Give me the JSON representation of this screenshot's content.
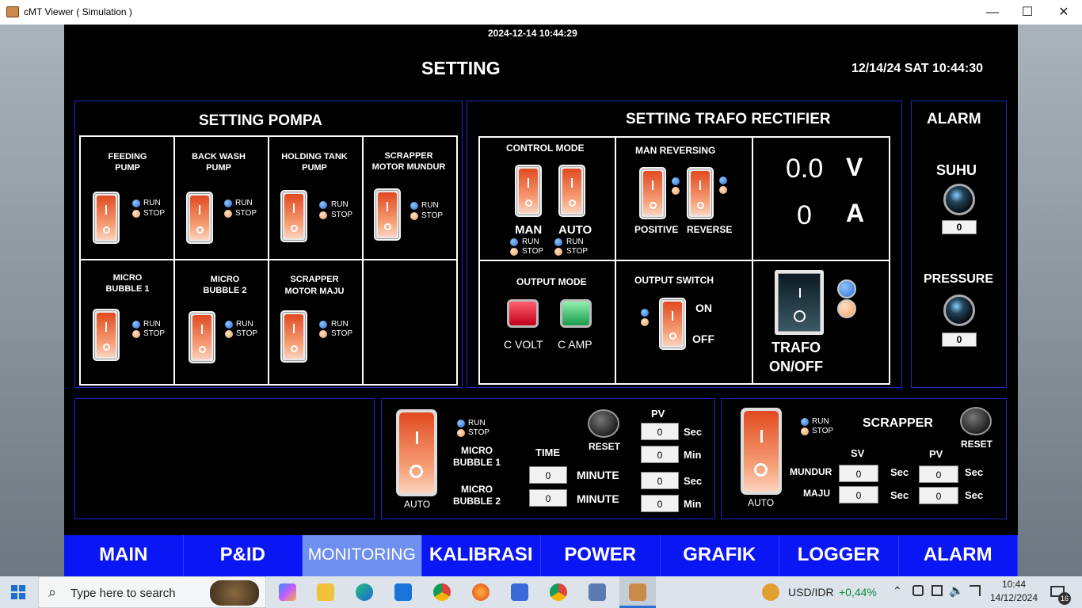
{
  "window": {
    "title": "cMT Viewer ( Simulation )",
    "min": "—",
    "max": "☐",
    "close": "✕"
  },
  "hmi": {
    "top_datetime": "2024-12-14 10:44:29",
    "page_title": "SETTING",
    "clock": "12/14/24 SAT 10:44:30",
    "pompa": {
      "title": "SETTING POMPA",
      "run": "RUN",
      "stop": "STOP",
      "pumps": [
        {
          "l1": "FEEDING",
          "l2": "PUMP"
        },
        {
          "l1": "BACK WASH",
          "l2": "PUMP"
        },
        {
          "l1": "HOLDING TANK",
          "l2": "PUMP"
        },
        {
          "l1": "SCRAPPER",
          "l2": "MOTOR MUNDUR"
        },
        {
          "l1": "MICRO",
          "l2": "BUBBLE 1"
        },
        {
          "l1": "MICRO",
          "l2": "BUBBLE 2"
        },
        {
          "l1": "SCRAPPER",
          "l2": "MOTOR MAJU"
        }
      ]
    },
    "trafo": {
      "title": "SETTING TRAFO RECTIFIER",
      "control_mode": "CONTROL MODE",
      "man": "MAN",
      "auto": "AUTO",
      "run": "RUN",
      "stop": "STOP",
      "man_reversing": "MAN REVERSING",
      "positive": "POSITIVE",
      "reverse": "REVERSE",
      "voltage": "0.0",
      "volt_unit": "V",
      "current": "0",
      "amp_unit": "A",
      "output_mode": "OUTPUT MODE",
      "c_volt": "C VOLT",
      "c_amp": "C AMP",
      "output_switch": "OUTPUT SWITCH",
      "on": "ON",
      "off": "OFF",
      "trafo_l1": "TRAFO",
      "trafo_l2": "ON/OFF"
    },
    "alarm": {
      "title": "ALARM",
      "suhu": "SUHU",
      "suhu_val": "0",
      "pressure": "PRESSURE",
      "pressure_val": "0"
    },
    "micro": {
      "run": "RUN",
      "stop": "STOP",
      "auto": "AUTO",
      "mb1_l1": "MICRO",
      "mb1_l2": "BUBBLE 1",
      "mb2_l1": "MICRO",
      "mb2_l2": "BUBBLE 2",
      "time": "TIME",
      "reset": "RESET",
      "pv": "PV",
      "t1": "0",
      "t2": "0",
      "minute1": "MINUTE",
      "minute2": "MINUTE",
      "pv1": "0",
      "pv2": "0",
      "pv3": "0",
      "pv4": "0",
      "u1": "Sec",
      "u2": "Min",
      "u3": "Sec",
      "u4": "Min"
    },
    "scrapper": {
      "run": "RUN",
      "stop": "STOP",
      "auto": "AUTO",
      "title": "SCRAPPER",
      "reset": "RESET",
      "sv": "SV",
      "pv": "PV",
      "mundur": "MUNDUR",
      "maju": "MAJU",
      "sv_mundur": "0",
      "sv_maju": "0",
      "pv_mundur": "0",
      "pv_maju": "0",
      "sec": "Sec"
    },
    "nav": [
      "MAIN",
      "P&ID",
      "MONITORING",
      "KALIBRASI",
      "POWER",
      "GRAFIK",
      "LOGGER",
      "ALARM"
    ],
    "nav_selected": 2
  },
  "taskbar": {
    "search_placeholder": "Type here to search",
    "ticker": "USD/IDR",
    "ticker_change": "+0,44%",
    "time": "10:44",
    "date": "14/12/2024",
    "notif_count": "16"
  }
}
